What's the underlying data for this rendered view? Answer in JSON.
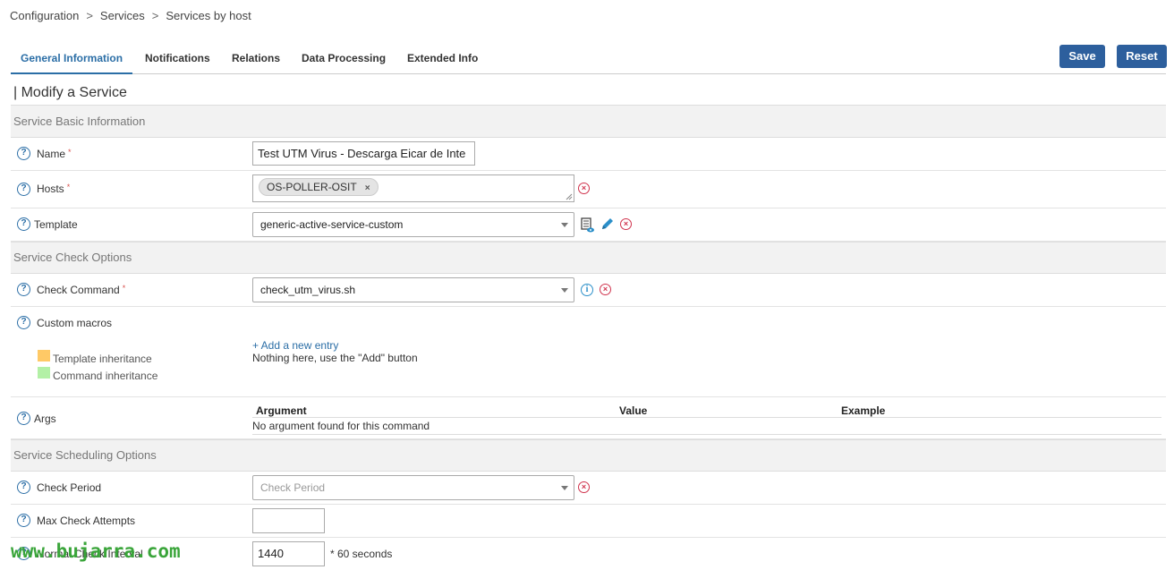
{
  "breadcrumb": [
    "Configuration",
    "Services",
    "Services by host"
  ],
  "tabs": [
    "General Information",
    "Notifications",
    "Relations",
    "Data Processing",
    "Extended Info"
  ],
  "buttons": {
    "save": "Save",
    "reset": "Reset"
  },
  "page_title": "| Modify a Service",
  "sections": {
    "basic": "Service Basic Information",
    "check": "Service Check Options",
    "scheduling": "Service Scheduling Options"
  },
  "fields": {
    "name": {
      "label": "Name",
      "required": "*",
      "value": "Test UTM Virus - Descarga Eicar de Inte"
    },
    "hosts": {
      "label": "Hosts",
      "required": "*",
      "chip": "OS-POLLER-OSIT",
      "chip_remove": "×"
    },
    "template": {
      "label": "Template",
      "value": "generic-active-service-custom"
    },
    "check_command": {
      "label": "Check Command",
      "required": "*",
      "value": "check_utm_virus.sh"
    },
    "custom_macros": {
      "label": "Custom macros",
      "legend_template": "Template inheritance",
      "legend_command": "Command inheritance",
      "add_link": "+ Add a new entry",
      "empty_text": "Nothing here, use the \"Add\" button"
    },
    "args": {
      "label": "Args",
      "columns": [
        "Argument",
        "Value",
        "Example"
      ],
      "empty_text": "No argument found for this command"
    },
    "check_period": {
      "label": "Check Period",
      "placeholder": "Check Period"
    },
    "max_check_attempts": {
      "label": "Max Check Attempts",
      "value": ""
    },
    "normal_check_interval": {
      "label": "Normal Check Interval",
      "value": "1440",
      "unit": "* 60 seconds"
    }
  },
  "colors": {
    "accent": "#2b6ea6",
    "button": "#2d5f9d",
    "legend_template": "#ffc966",
    "legend_command": "#b3f0a6",
    "delete": "#d0334d"
  },
  "watermark": "www.bujarra.com"
}
